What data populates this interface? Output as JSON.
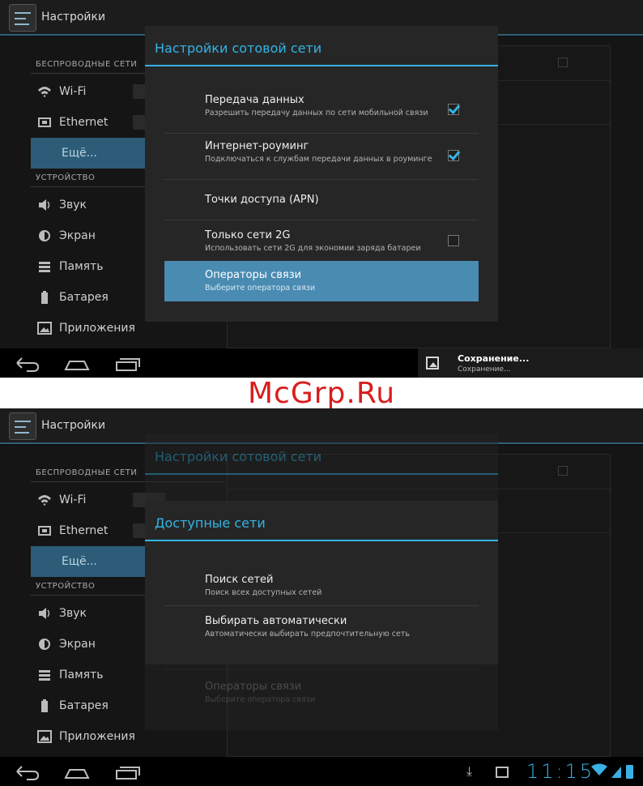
{
  "app": {
    "title": "Настройки"
  },
  "sidebar": {
    "wireless_header": "БЕСПРОВОДНЫЕ СЕТИ",
    "device_header": "УСТРОЙСТВО",
    "items": [
      {
        "label": "Wi-Fi",
        "icon": "wifi-icon"
      },
      {
        "label": "Ethernet",
        "icon": "ethernet-icon"
      },
      {
        "label": "Ещё...",
        "icon": ""
      },
      {
        "label": "Звук",
        "icon": "speaker-icon"
      },
      {
        "label": "Экран",
        "icon": "brightness-icon"
      },
      {
        "label": "Память",
        "icon": "storage-icon"
      },
      {
        "label": "Батарея",
        "icon": "battery-icon"
      },
      {
        "label": "Приложения",
        "icon": "apps-icon"
      }
    ]
  },
  "mobile_dialog": {
    "title": "Настройки сотовой сети",
    "items": [
      {
        "title": "Передача данных",
        "summary": "Разрешить передачу данных по сети мобильной связи",
        "checked": true
      },
      {
        "title": "Интернет-роуминг",
        "summary": "Подключаться к службам передачи данных в роуминге",
        "checked": true
      },
      {
        "title": "Точки доступа (APN)",
        "summary": ""
      },
      {
        "title": "Только сети 2G",
        "summary": "Использовать сети 2G для экономии заряда батареи",
        "checked": false
      },
      {
        "title": "Операторы связи",
        "summary": "Выберите оператора связи"
      }
    ]
  },
  "networks_dialog": {
    "title": "Доступные сети",
    "items": [
      {
        "title": "Поиск сетей",
        "summary": "Поиск всех доступных сетей"
      },
      {
        "title": "Выбирать автоматически",
        "summary": "Автоматически выбирать предпочтительную сеть"
      }
    ]
  },
  "notification": {
    "title": "Сохранение...",
    "subtitle": "Сохранение..."
  },
  "status": {
    "time": "11:15"
  },
  "watermark": "McGrp.Ru",
  "colors": {
    "accent": "#33b5e5",
    "selected": "#2c5c77",
    "highlight": "#4a8bb2",
    "watermark": "#d81e1e"
  }
}
